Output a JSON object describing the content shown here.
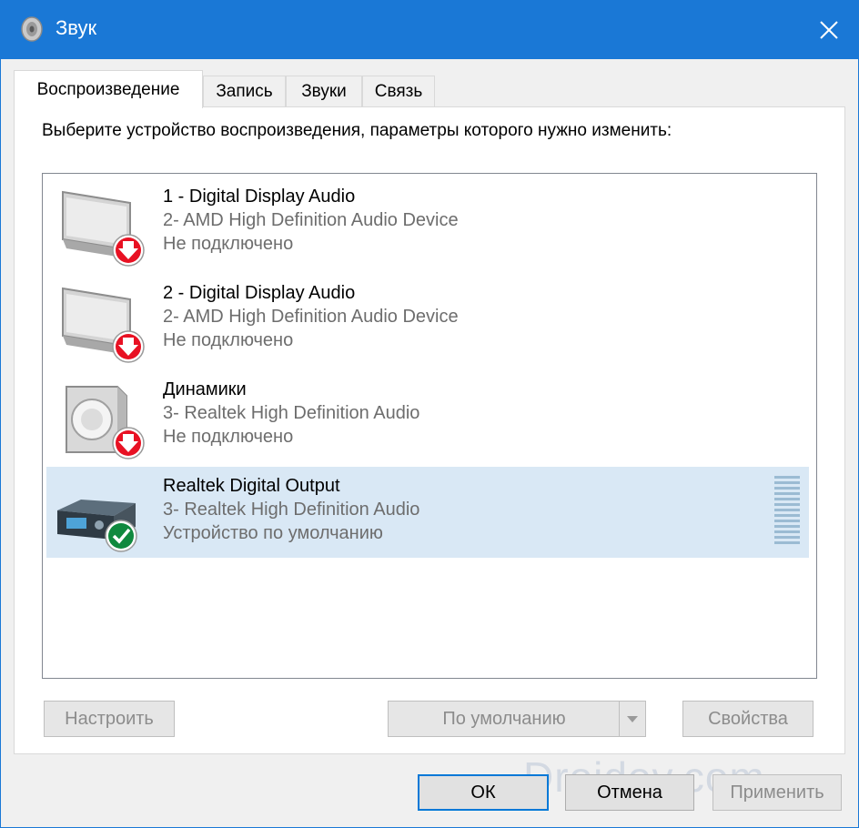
{
  "window": {
    "title": "Звук",
    "close_glyph": "✕"
  },
  "tabs": [
    {
      "label": "Воспроизведение",
      "active": true
    },
    {
      "label": "Запись",
      "active": false
    },
    {
      "label": "Звуки",
      "active": false
    },
    {
      "label": "Связь",
      "active": false
    }
  ],
  "instruction": "Выберите устройство воспроизведения, параметры которого нужно изменить:",
  "devices": [
    {
      "name": "1 - Digital Display Audio",
      "driver": "2- AMD High Definition Audio Device",
      "status": "Не подключено",
      "icon": "monitor-icon",
      "badge": "disconnected-arrow-icon"
    },
    {
      "name": "2 - Digital Display Audio",
      "driver": "2- AMD High Definition Audio Device",
      "status": "Не подключено",
      "icon": "monitor-icon",
      "badge": "disconnected-arrow-icon"
    },
    {
      "name": "Динамики",
      "driver": "3- Realtek High Definition Audio",
      "status": "Не подключено",
      "icon": "speaker-icon",
      "badge": "disconnected-arrow-icon"
    },
    {
      "name": "Realtek Digital Output",
      "driver": "3- Realtek High Definition Audio",
      "status": "Устройство по умолчанию",
      "icon": "digital-output-icon",
      "badge": "default-check-icon",
      "selected": true
    }
  ],
  "buttons": {
    "configure": "Настроить",
    "set_default": "По умолчанию",
    "properties": "Свойства",
    "ok": "ОК",
    "cancel": "Отмена",
    "apply": "Применить"
  },
  "watermark": "Droidov.com",
  "colors": {
    "titlebar": "#1a78d6",
    "selection": "#d9e8f5",
    "disconnected_badge": "#e81123",
    "default_badge": "#10893e"
  }
}
